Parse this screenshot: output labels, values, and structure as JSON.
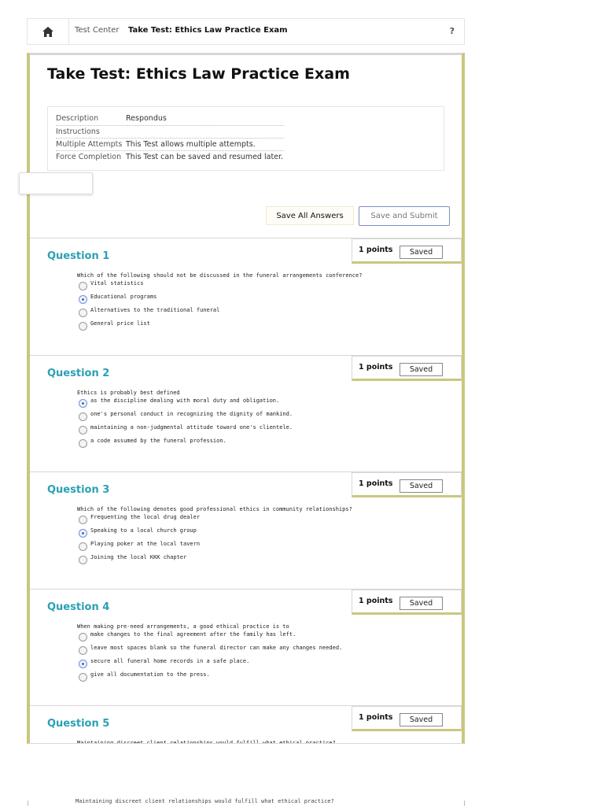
{
  "breadcrumb": {
    "home_icon": "home-icon",
    "crumb1": "Test Center",
    "crumb2": "Take Test: Ethics Law Practice Exam",
    "help": "?"
  },
  "page": {
    "title": "Take Test: Ethics Law Practice Exam"
  },
  "details": {
    "rows": [
      {
        "label": "Description",
        "value": "Respondus"
      },
      {
        "label": "Instructions",
        "value": ""
      },
      {
        "label": "Multiple Attempts",
        "value": "This Test allows multiple attempts."
      },
      {
        "label": "Force Completion",
        "value": "This Test can be saved and resumed later."
      }
    ]
  },
  "actions": {
    "save_all": "Save All Answers",
    "save_submit": "Save and Submit"
  },
  "questions": [
    {
      "title": "Question 1",
      "points": "1 points",
      "status": "Saved",
      "text": "Which of the following should not be discussed in the funeral arrangements conference?",
      "options": [
        "Vital statistics",
        "Educational programs",
        "Alternatives to the traditional funeral",
        "General price list"
      ],
      "selected": 1
    },
    {
      "title": "Question 2",
      "points": "1 points",
      "status": "Saved",
      "text": "Ethics is probably best defined",
      "options": [
        "as the discipline dealing with moral duty and obligation.",
        "one's personal conduct in recognizing the dignity of mankind.",
        "maintaining a non-judgmental attitude toward one's clientele.",
        "a code assumed by the funeral profession."
      ],
      "selected": 0
    },
    {
      "title": "Question 3",
      "points": "1 points",
      "status": "Saved",
      "text": "Which of the following denotes good professional ethics in community relationships?",
      "options": [
        "Frequenting the local drug dealer",
        "Speaking to a local church group",
        "Playing poker at the local tavern",
        "Joining the local KKK chapter"
      ],
      "selected": 1
    },
    {
      "title": "Question 4",
      "points": "1 points",
      "status": "Saved",
      "text": "When making pre-need arrangements, a good ethical practice is to",
      "options": [
        "make changes to the final agreement after the family has left.",
        "leave most spaces blank so the funeral director can make any changes needed.",
        "secure all funeral home records in a safe place.",
        "give all documentation to the press."
      ],
      "selected": 2
    },
    {
      "title": "Question 5",
      "points": "1 points",
      "status": "Saved",
      "text": "Maintaining discreet client relationships would fulfill what ethical practice?",
      "options": [],
      "selected": -1
    }
  ]
}
